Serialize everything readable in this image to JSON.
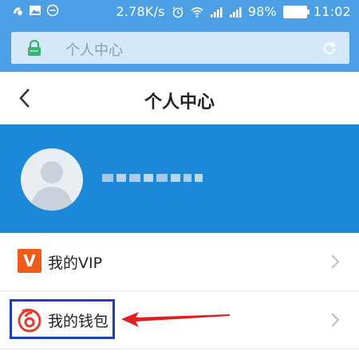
{
  "status_bar": {
    "network_speed": "2.78K/s",
    "battery": "98%",
    "time": "11:02"
  },
  "browser": {
    "url_text": "个人中心",
    "lock_icon": "lock-icon",
    "reload_icon": "reload-icon"
  },
  "header": {
    "title": "个人中心",
    "back_icon": "chevron-left-icon"
  },
  "profile": {
    "avatar_icon": "avatar-placeholder",
    "name_blurred": true
  },
  "menu": {
    "items": [
      {
        "label": "我的VIP",
        "badge": "V",
        "badge_color": "#f05a1a"
      },
      {
        "label": "我的钱包",
        "icon": "wallet-icon",
        "icon_color": "#e43b2e"
      }
    ]
  },
  "annotation": {
    "box_color": "#1c3fb8",
    "arrow_color": "#e02020"
  },
  "colors": {
    "status_bg": "#4c9fe4",
    "banner_bg": "#1e88d8"
  }
}
